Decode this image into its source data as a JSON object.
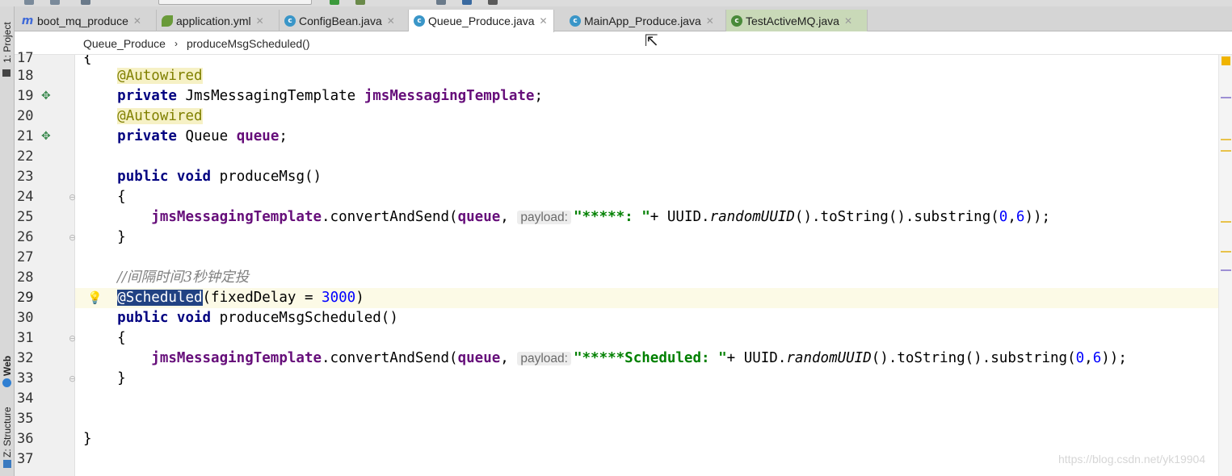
{
  "tabs": [
    {
      "label": "boot_mq_produce",
      "icon": "module-icon",
      "active": false
    },
    {
      "label": "application.yml",
      "icon": "yml-config-icon",
      "active": false
    },
    {
      "label": "ConfigBean.java",
      "icon": "java-class-icon",
      "active": false
    },
    {
      "label": "Queue_Produce.java",
      "icon": "java-class-icon",
      "active": true
    },
    {
      "label": "MainApp_Produce.java",
      "icon": "spring-boot-class-icon",
      "active": false
    },
    {
      "label": "TestActiveMQ.java",
      "icon": "test-class-icon",
      "active": false
    }
  ],
  "tool_windows": {
    "project": "1: Project",
    "web": "Web",
    "structure": "Z: Structure"
  },
  "breadcrumb": {
    "class": "Queue_Produce",
    "method": "produceMsgScheduled()"
  },
  "editor": {
    "current_line": 29,
    "lines": [
      {
        "n": "17",
        "text": "{"
      },
      {
        "n": "18",
        "text": "    @Autowired"
      },
      {
        "n": "19",
        "text": "    private JmsMessagingTemplate jmsMessagingTemplate;"
      },
      {
        "n": "20",
        "text": "    @Autowired"
      },
      {
        "n": "21",
        "text": "    private Queue queue;"
      },
      {
        "n": "22",
        "text": ""
      },
      {
        "n": "23",
        "text": "    public void produceMsg()"
      },
      {
        "n": "24",
        "text": "    {"
      },
      {
        "n": "25",
        "text": "        jmsMessagingTemplate.convertAndSend(queue, payload: \"*****: \"+ UUID.randomUUID().toString().substring(0,6));"
      },
      {
        "n": "26",
        "text": "    }"
      },
      {
        "n": "27",
        "text": ""
      },
      {
        "n": "28",
        "text": "    //间隔时间3秒钟定投"
      },
      {
        "n": "29",
        "text": "    @Scheduled(fixedDelay = 3000)"
      },
      {
        "n": "30",
        "text": "    public void produceMsgScheduled()"
      },
      {
        "n": "31",
        "text": "    {"
      },
      {
        "n": "32",
        "text": "        jmsMessagingTemplate.convertAndSend(queue, payload: \"*****Scheduled: \"+ UUID.randomUUID().toString().substring(0,6));"
      },
      {
        "n": "33",
        "text": "    }"
      },
      {
        "n": "34",
        "text": ""
      },
      {
        "n": "35",
        "text": ""
      },
      {
        "n": "36",
        "text": "}"
      },
      {
        "n": "37",
        "text": ""
      }
    ],
    "tokens": {
      "annotation_autowired": "@Autowired",
      "annotation_scheduled": "@Scheduled",
      "kw_private": "private",
      "kw_public": "public",
      "kw_void": "void",
      "type_template": "JmsMessagingTemplate",
      "type_queue": "Queue",
      "field_template": "jmsMessagingTemplate",
      "field_queue": "queue",
      "method_produce": "produceMsg()",
      "method_scheduled": "produceMsgScheduled()",
      "call_convert": ".convertAndSend(",
      "param_hint": "payload:",
      "str_1": "\"*****: \"",
      "str_2": "\"*****Scheduled: \"",
      "uuid_prefix": "+ UUID.",
      "random_uuid": "randomUUID",
      "chain": "().toString().substring(",
      "num_0": "0",
      "num_6": "6",
      "chain_end": "));",
      "comment": "//间隔时间3秒钟定投",
      "fixed_delay": "(fixedDelay = ",
      "delay_value": "3000",
      "close_paren": ")",
      "open_brace": "{",
      "close_brace": "}",
      "semicolon": ";",
      "comma": ", "
    }
  },
  "watermark": "https://blog.csdn.net/yk19904",
  "colors": {
    "keyword": "#000080",
    "annotation": "#808000",
    "field": "#660e7a",
    "string": "#008000",
    "number": "#0000ff",
    "selection": "#214283",
    "current_line": "#fcfae6"
  }
}
